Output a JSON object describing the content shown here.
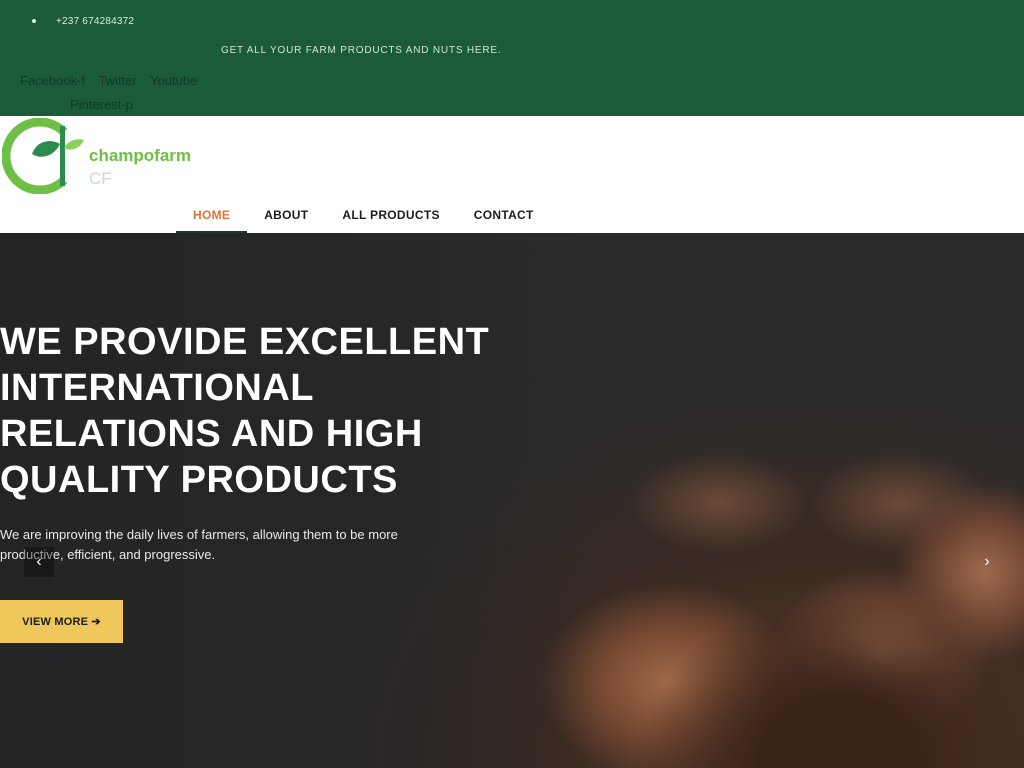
{
  "topbar": {
    "phone": "+237 674284372",
    "tagline": "GET ALL YOUR FARM PRODUCTS AND NUTS HERE.",
    "social": [
      "Facebook-f",
      "Twitter",
      "Youtube"
    ],
    "social2": "Pinterest-p"
  },
  "header": {
    "brand_line1": "champofarm",
    "brand_line2": "CF",
    "nav": [
      "HOME",
      "ABOUT",
      "ALL PRODUCTS",
      "CONTACT"
    ]
  },
  "hero": {
    "headline": "WE PROVIDE EXCELLENT INTERNATIONAL RELATIONS AND HIGH QUALITY PRODUCTS",
    "subtext": "We are improving the daily lives of farmers, allowing them to be more productive, efficient, and progressive.",
    "cta": "VIEW MORE ➔",
    "prev": "‹",
    "next": "›"
  },
  "colors": {
    "topbar": "#1b5b3a",
    "accent": "#e0743b",
    "cta": "#f0c75a"
  }
}
